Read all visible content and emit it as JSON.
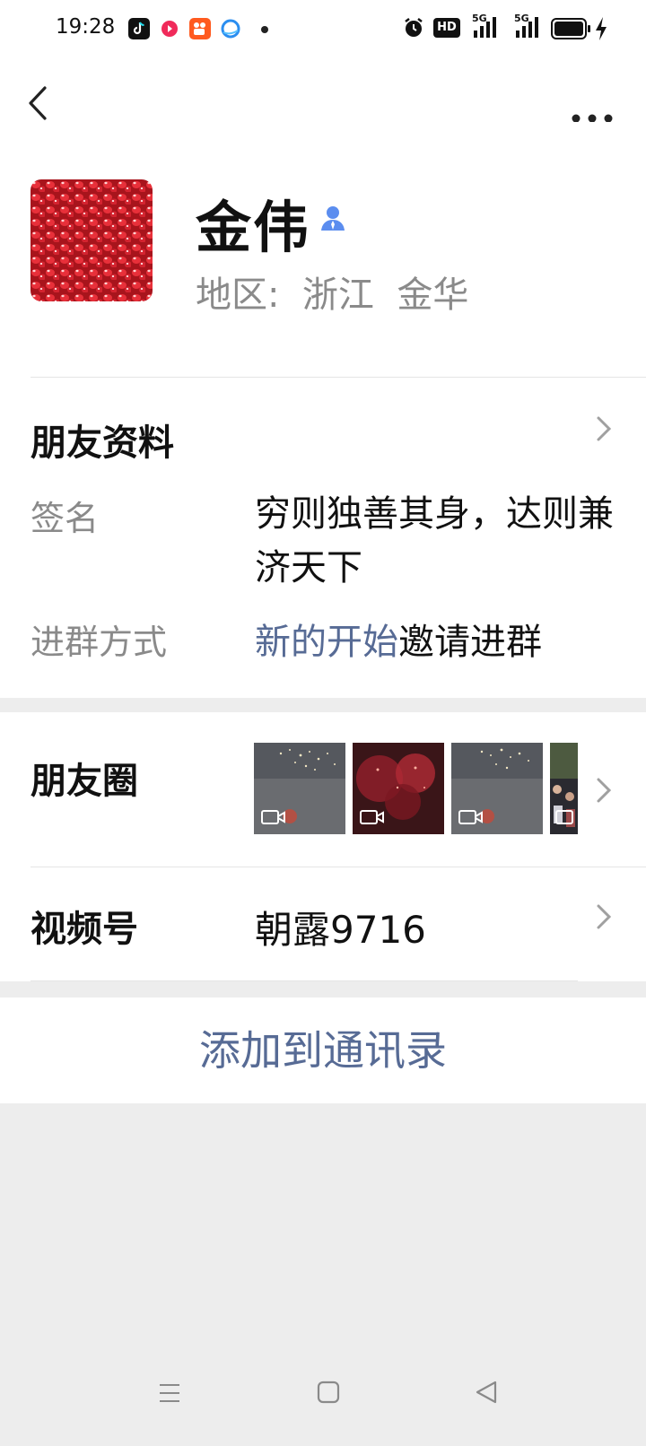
{
  "status_bar": {
    "time": "19:28",
    "apps": [
      "tiktok-icon",
      "red-app-icon",
      "kuaishou-icon",
      "browser-icon"
    ],
    "hd_label": "HD",
    "network_1": "5G",
    "network_2": "5G"
  },
  "profile": {
    "name": "金伟",
    "region_label": "地区:",
    "region_value": "浙江  金华"
  },
  "friend_info": {
    "title": "朋友资料",
    "signature_label": "签名",
    "signature_value": "穷则独善其身，达则兼济天下",
    "join_label": "进群方式",
    "join_link": "新的开始",
    "join_suffix": "邀请进群"
  },
  "moments": {
    "title": "朋友圈",
    "thumbnails": [
      "fireworks-video-1",
      "fireworks-video-2",
      "fireworks-video-3",
      "crowd-video-4"
    ]
  },
  "channels": {
    "title": "视频号",
    "value": "朝露9716"
  },
  "actions": {
    "add_contact": "添加到通讯录"
  },
  "colors": {
    "link": "#576b95",
    "background": "#ededed"
  }
}
